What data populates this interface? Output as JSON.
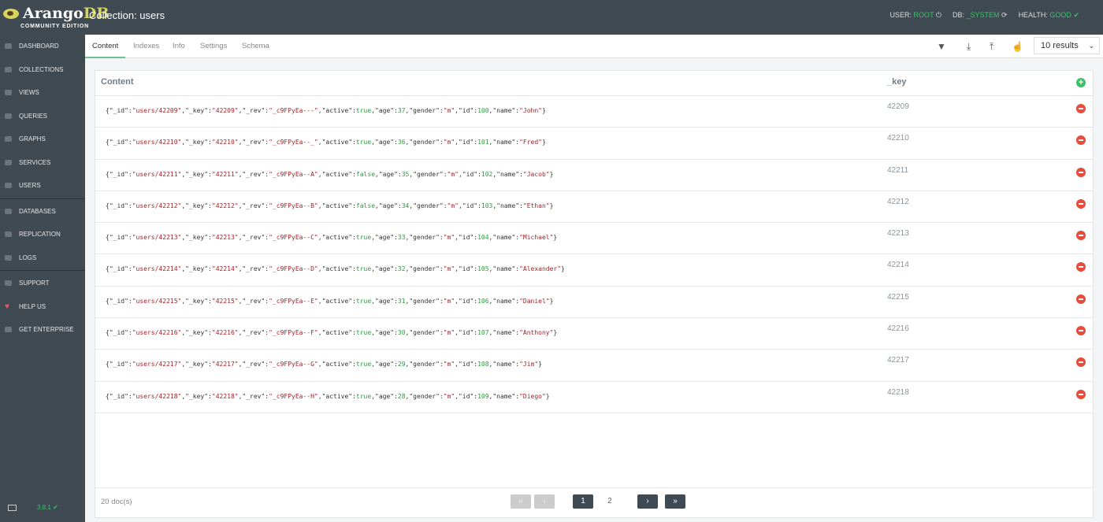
{
  "header": {
    "logo": "ArangoDB",
    "edition": "COMMUNITY EDITION",
    "title": "Collection: users",
    "user_label": "USER:",
    "user": "ROOT",
    "db_label": "DB:",
    "db": "_SYSTEM",
    "health_label": "HEALTH:",
    "health": "GOOD"
  },
  "sidebar": {
    "groups": [
      [
        "DASHBOARD",
        "COLLECTIONS",
        "VIEWS",
        "QUERIES",
        "GRAPHS",
        "SERVICES",
        "USERS"
      ],
      [
        "DATABASES",
        "REPLICATION",
        "LOGS"
      ],
      [
        "SUPPORT",
        "HELP US",
        "GET ENTERPRISE"
      ]
    ],
    "version": "3.8.1"
  },
  "tabs": [
    "Content",
    "Indexes",
    "Info",
    "Settings",
    "Schema"
  ],
  "active_tab": "Content",
  "toolbar": {
    "icons": [
      "filter-icon",
      "download-icon",
      "upload-icon",
      "hand-pointer-icon"
    ],
    "results": "10 results"
  },
  "table": {
    "col_content": "Content",
    "col_key": "_key",
    "rows": [
      {
        "key": "42209",
        "doc": "{\"_id\":\"users/42209\",\"_key\":\"42209\",\"_rev\":\"_c9FPyEa---\",\"active\":true,\"age\":37,\"gender\":\"m\",\"id\":100,\"name\":\"John\"}"
      },
      {
        "key": "42210",
        "doc": "{\"_id\":\"users/42210\",\"_key\":\"42210\",\"_rev\":\"_c9FPyEa--_\",\"active\":true,\"age\":36,\"gender\":\"m\",\"id\":101,\"name\":\"Fred\"}"
      },
      {
        "key": "42211",
        "doc": "{\"_id\":\"users/42211\",\"_key\":\"42211\",\"_rev\":\"_c9FPyEa--A\",\"active\":false,\"age\":35,\"gender\":\"m\",\"id\":102,\"name\":\"Jacob\"}"
      },
      {
        "key": "42212",
        "doc": "{\"_id\":\"users/42212\",\"_key\":\"42212\",\"_rev\":\"_c9FPyEa--B\",\"active\":false,\"age\":34,\"gender\":\"m\",\"id\":103,\"name\":\"Ethan\"}"
      },
      {
        "key": "42213",
        "doc": "{\"_id\":\"users/42213\",\"_key\":\"42213\",\"_rev\":\"_c9FPyEa--C\",\"active\":true,\"age\":33,\"gender\":\"m\",\"id\":104,\"name\":\"Michael\"}"
      },
      {
        "key": "42214",
        "doc": "{\"_id\":\"users/42214\",\"_key\":\"42214\",\"_rev\":\"_c9FPyEa--D\",\"active\":true,\"age\":32,\"gender\":\"m\",\"id\":105,\"name\":\"Alexander\"}"
      },
      {
        "key": "42215",
        "doc": "{\"_id\":\"users/42215\",\"_key\":\"42215\",\"_rev\":\"_c9FPyEa--E\",\"active\":true,\"age\":31,\"gender\":\"m\",\"id\":106,\"name\":\"Daniel\"}"
      },
      {
        "key": "42216",
        "doc": "{\"_id\":\"users/42216\",\"_key\":\"42216\",\"_rev\":\"_c9FPyEa--F\",\"active\":true,\"age\":30,\"gender\":\"m\",\"id\":107,\"name\":\"Anthony\"}"
      },
      {
        "key": "42217",
        "doc": "{\"_id\":\"users/42217\",\"_key\":\"42217\",\"_rev\":\"_c9FPyEa--G\",\"active\":true,\"age\":29,\"gender\":\"m\",\"id\":108,\"name\":\"Jim\"}"
      },
      {
        "key": "42218",
        "doc": "{\"_id\":\"users/42218\",\"_key\":\"42218\",\"_rev\":\"_c9FPyEa--H\",\"active\":true,\"age\":28,\"gender\":\"m\",\"id\":109,\"name\":\"Diego\"}"
      }
    ]
  },
  "footer": {
    "count": "20 doc(s)",
    "pages": [
      "1",
      "2"
    ],
    "first": "«",
    "prev": "‹",
    "next": "›",
    "last": "»",
    "current_page": 1
  },
  "colors": {
    "topbar": "#404a53",
    "accent_green": "#3fbf6a",
    "delete_red": "#e74c3c"
  }
}
